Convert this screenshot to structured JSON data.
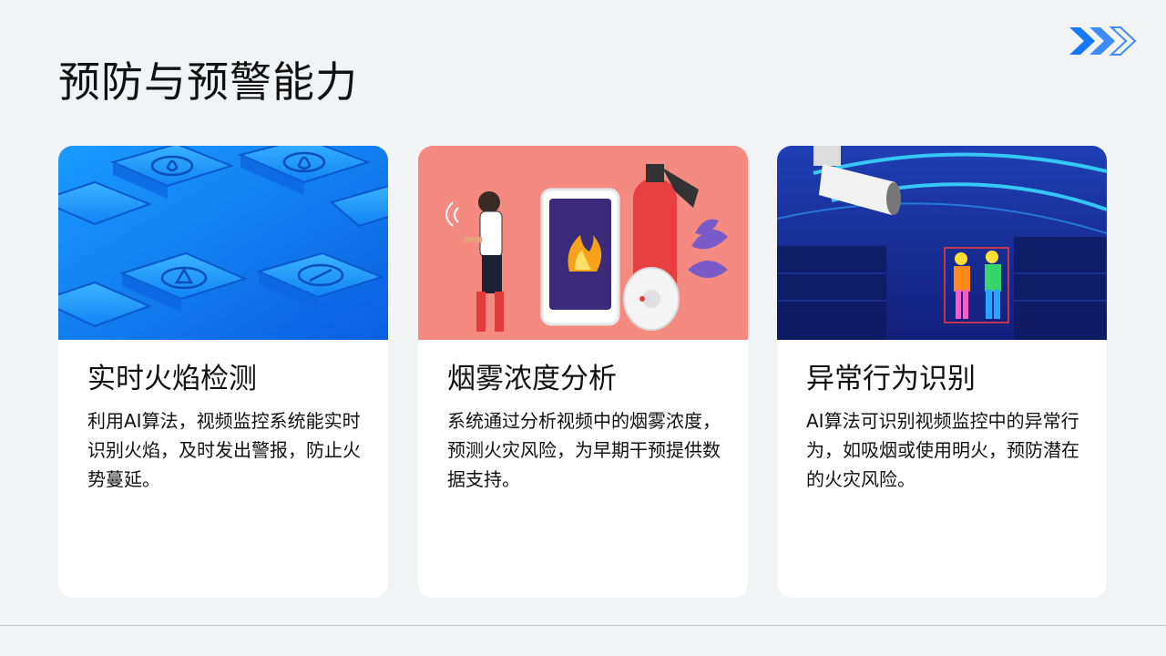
{
  "page": {
    "title": "预防与预警能力"
  },
  "colors": {
    "background": "#f2f3f5",
    "accent_blue": "#1677ff",
    "card_bg": "#ffffff"
  },
  "header_icon": "triple-chevron-right-icon",
  "cards": [
    {
      "title": "实时火焰检测",
      "text": "利用AI算法，视频监控系统能实时识别火焰，及时发出警报，防止火势蔓延。",
      "image": "isometric-blue-fire-icons-illustration"
    },
    {
      "title": "烟雾浓度分析",
      "text": "系统通过分析视频中的烟雾浓度，预测火灾风险，为早期干预提供数据支持。",
      "image": "smartphone-fire-alarm-extinguisher-illustration"
    },
    {
      "title": "异常行为识别",
      "text": "AI算法可识别视频监控中的异常行为，如吸烟或使用明火，预防潜在的火灾风险。",
      "image": "thermal-camera-surveillance-photo"
    }
  ]
}
